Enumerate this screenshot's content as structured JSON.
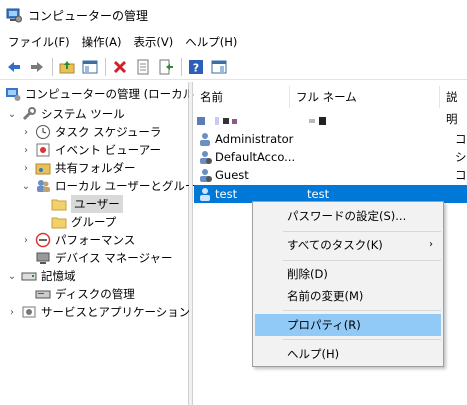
{
  "window": {
    "title": "コンピューターの管理"
  },
  "menu": [
    "ファイル(F)",
    "操作(A)",
    "表示(V)",
    "ヘルプ(H)"
  ],
  "toolbar": [
    "back-icon",
    "forward-icon",
    "up-folder-icon",
    "show-tree-icon",
    "delete-icon",
    "properties-icon",
    "export-icon",
    "help-icon",
    "show-pane-icon"
  ],
  "tree": {
    "root": "コンピューターの管理 (ローカル)",
    "system_tools": "システム ツール",
    "task_scheduler": "タスク スケジューラ",
    "event_viewer": "イベント ビューアー",
    "shared_folders": "共有フォルダー",
    "local_users_groups": "ローカル ユーザーとグループ",
    "users": "ユーザー",
    "groups": "グループ",
    "performance": "パフォーマンス",
    "device_manager": "デバイス マネージャー",
    "storage": "記憶域",
    "disk_management": "ディスクの管理",
    "services_apps": "サービスとアプリケーション"
  },
  "list": {
    "columns": [
      "名前",
      "フル ネーム",
      "説明"
    ],
    "rows": [
      {
        "name": "Administrator",
        "full_name": "",
        "desc": "コン"
      },
      {
        "name": "DefaultAcco...",
        "full_name": "",
        "desc": "シス"
      },
      {
        "name": "Guest",
        "full_name": "",
        "desc": "コン"
      },
      {
        "name": "test",
        "full_name": "test",
        "desc": ""
      }
    ]
  },
  "context_menu": {
    "set_password": "パスワードの設定(S)...",
    "all_tasks": "すべてのタスク(K)",
    "delete": "削除(D)",
    "rename": "名前の変更(M)",
    "properties": "プロパティ(R)",
    "help": "ヘルプ(H)",
    "submenu_arrow": "›"
  },
  "colors": {
    "selection": "#0078d7",
    "menu_highlight": "#91c9f7"
  }
}
